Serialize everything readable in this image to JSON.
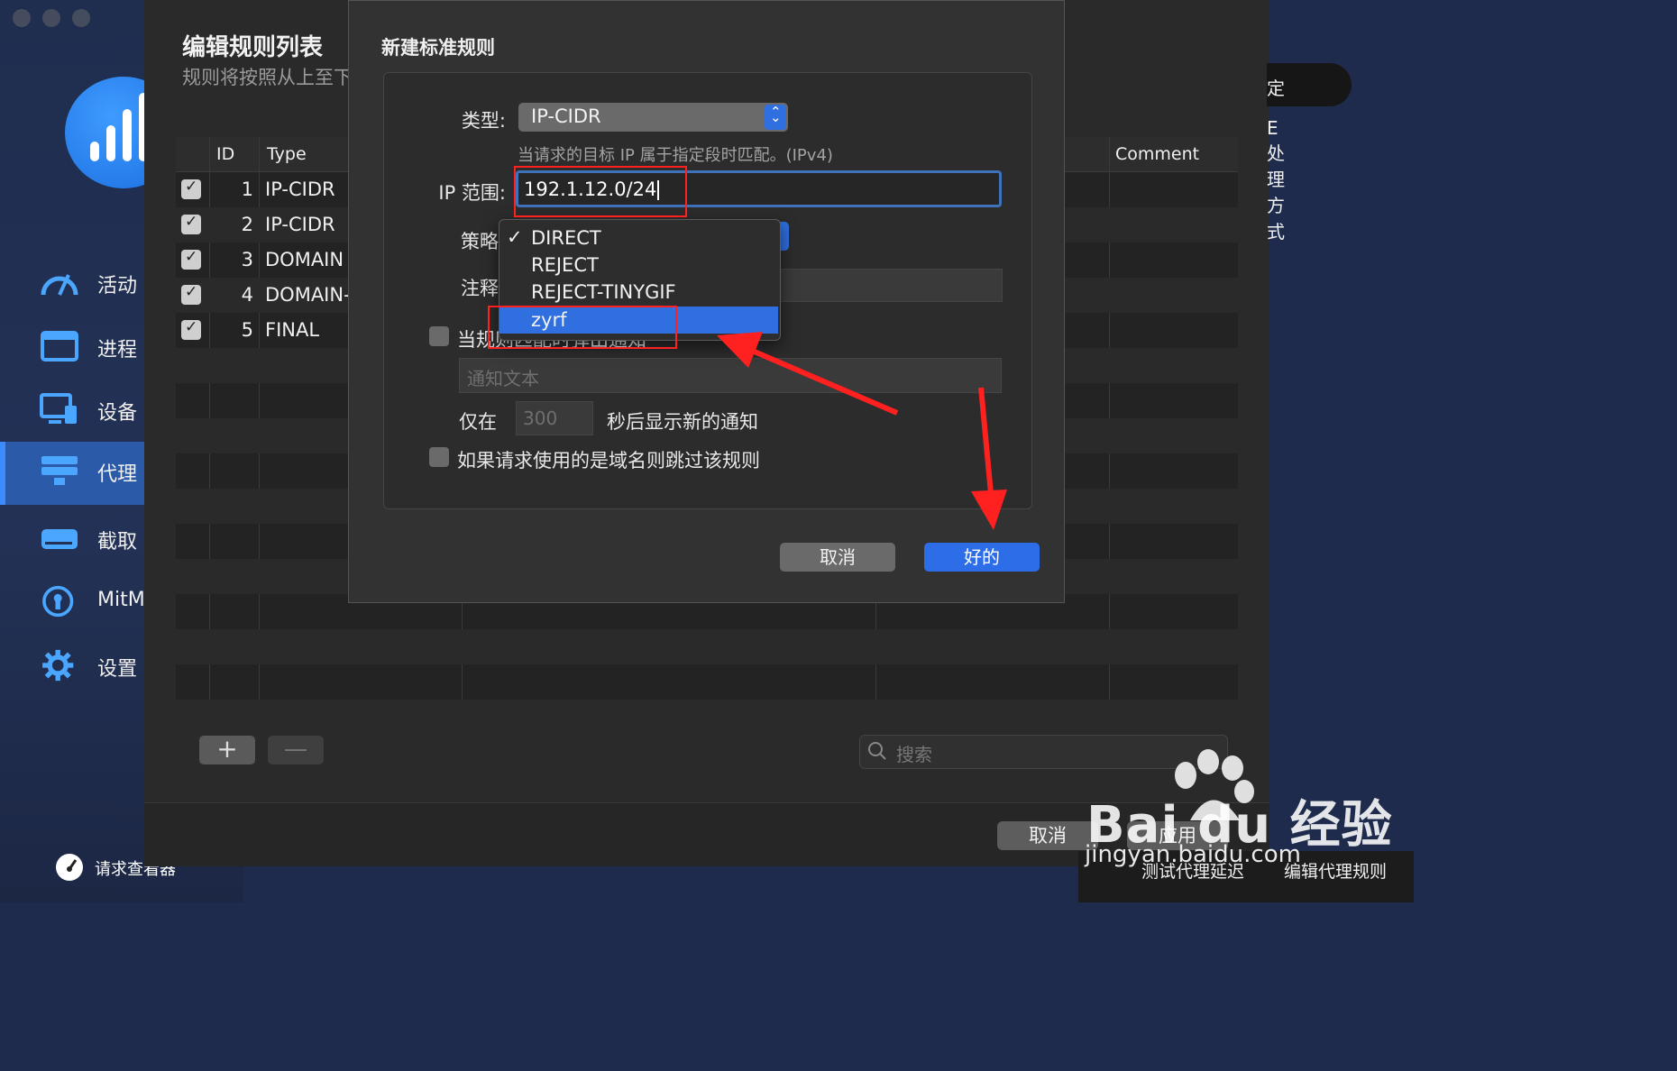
{
  "sidebar": {
    "nav": [
      {
        "label": "活动",
        "icon": "speedometer-icon"
      },
      {
        "label": "进程",
        "icon": "window-icon"
      },
      {
        "label": "设备",
        "icon": "device-icon"
      },
      {
        "label": "代理",
        "icon": "server-icon",
        "active": true
      },
      {
        "label": "截取",
        "icon": "drive-icon"
      },
      {
        "label": "MitM",
        "icon": "keyhole-icon"
      },
      {
        "label": "设置",
        "icon": "gear-icon"
      }
    ],
    "request_viewer": "请求查看器"
  },
  "rule_window": {
    "title": "编辑规则列表",
    "subtitle": "规则将按照从上至下",
    "columns": {
      "id": "ID",
      "type": "Type",
      "comment": "Comment"
    },
    "rows": [
      {
        "id": "1",
        "type": "IP-CIDR",
        "checked": true
      },
      {
        "id": "2",
        "type": "IP-CIDR",
        "checked": true
      },
      {
        "id": "3",
        "type": "DOMAIN",
        "checked": true
      },
      {
        "id": "4",
        "type": "DOMAIN-",
        "checked": true
      },
      {
        "id": "5",
        "type": "FINAL",
        "checked": true
      }
    ],
    "add_label": "+",
    "remove_label": "—",
    "search_placeholder": "搜索",
    "top_right_fragment": "定",
    "top_right_text": "E处理方式",
    "cancel": "取消",
    "apply": "应用"
  },
  "bottom_bar": {
    "test_latency": "测试代理延迟",
    "edit_rules": "编辑代理规则"
  },
  "dialog": {
    "title": "新建标准规则",
    "type_label": "类型:",
    "type_value": "IP-CIDR",
    "type_hint": "当请求的目标 IP 属于指定段时匹配。(IPv4)",
    "ip_label": "IP 范围:",
    "ip_value": "192.1.12.0/24",
    "policy_label": "策略",
    "comment_label": "注释",
    "notify_label": "当规则匹配时弹出通知",
    "notify_placeholder": "通知文本",
    "only_label": "仅在",
    "seconds_placeholder": "300",
    "seconds_label": "秒后显示新的通知",
    "skip_label": "如果请求使用的是域名则跳过该规则",
    "cancel": "取消",
    "ok": "好的"
  },
  "policy_menu": {
    "items": [
      "DIRECT",
      "REJECT",
      "REJECT-TINYGIF",
      "zyrf"
    ],
    "checked": "DIRECT",
    "highlighted": "zyrf",
    "check_mark": "✓"
  },
  "watermark": {
    "brand": "Bai du 经验",
    "url": "jingyan.baidu.com"
  },
  "colors": {
    "accent": "#2f6fe0",
    "sidebar_active": "#2b5ba8",
    "annotation": "#ff2020"
  }
}
